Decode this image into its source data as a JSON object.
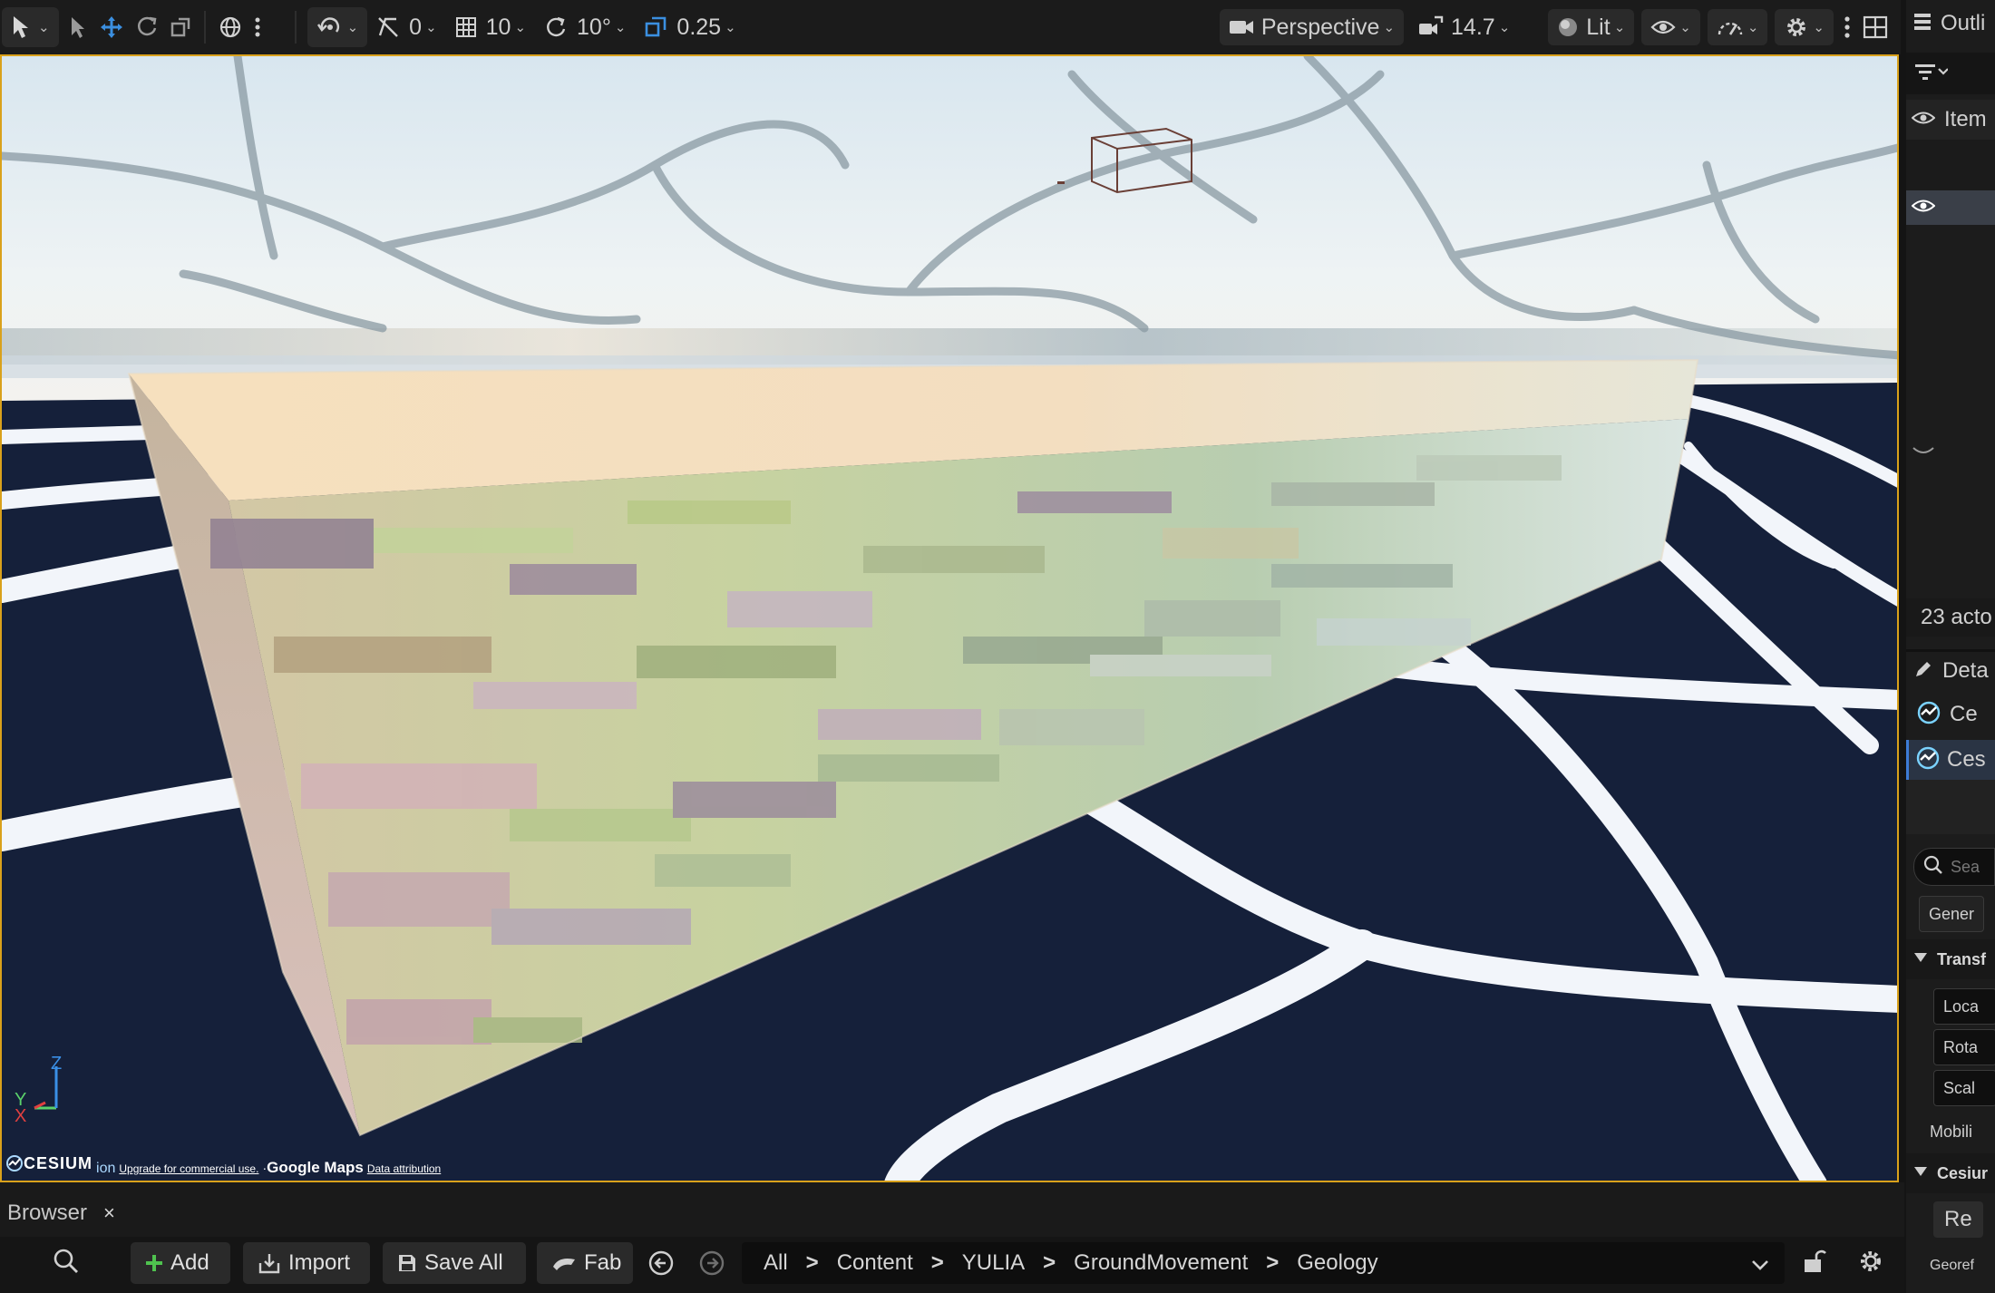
{
  "viewport_toolbar": {
    "translate_snap": "0",
    "grid_snap": "10",
    "rotation_snap": "10°",
    "scale_snap": "0.25",
    "view_mode": "Perspective",
    "camera_speed": "14.7",
    "lighting_mode": "Lit",
    "icons": [
      "select-mode-icon",
      "cursor-arrow-icon",
      "move-gizmo-icon",
      "rotate-icon",
      "scale-icon",
      "globe-icon",
      "more-icon",
      "surface-snap-icon",
      "translate-snap-icon",
      "grid-snap-icon",
      "rotation-snap-icon",
      "scale-snap-icon",
      "camera-icon",
      "camera-speed-icon",
      "lit-sphere-icon",
      "eye-icon",
      "performance-icon",
      "gear-icon",
      "layout-icon"
    ]
  },
  "viewport": {
    "gizmo": {
      "z": "Z",
      "y": "Y",
      "x": "X"
    },
    "attribution": {
      "cesium_logo": "CESIUM",
      "ion": "ion",
      "upgrade": "Upgrade for commercial use.",
      "google_maps": "Google Maps",
      "data_attribution": "Data attribution"
    },
    "accent_border": "#d9a11b"
  },
  "content_browser": {
    "tab_label": "Browser",
    "close_glyph": "×",
    "toolbar": {
      "add": "Add",
      "import": "Import",
      "save_all": "Save All",
      "fab": "Fab"
    },
    "path": [
      "All",
      "Content",
      "YULIA",
      "GroundMovement",
      "Geology"
    ],
    "separator": ">"
  },
  "right_panel": {
    "outliner_title": "Outli",
    "item_label": "Item",
    "actor_count": "23 acto",
    "details_title": "Deta",
    "component_1": "Ce",
    "component_2": "Ces",
    "search_placeholder": "Sea",
    "general_tab": "Gener",
    "transform_section": "Transf",
    "location": "Loca",
    "rotation": "Rota",
    "scale": "Scal",
    "mobility": "Mobili",
    "cesium_section": "Cesiur",
    "refresh_button": "Re",
    "georef": "Georef"
  }
}
